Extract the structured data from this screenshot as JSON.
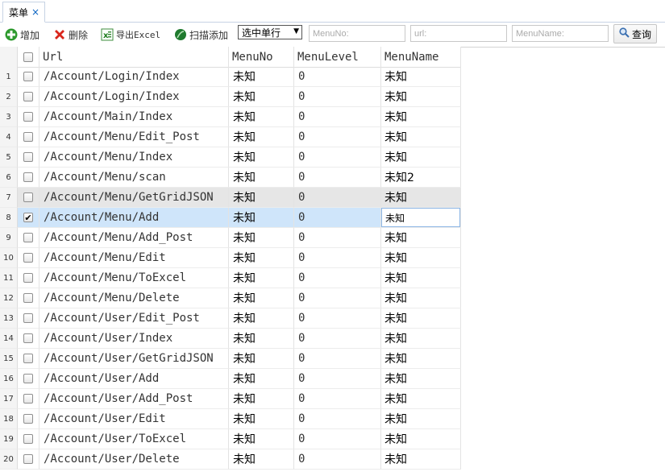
{
  "tab": {
    "label": "菜单",
    "close": "×"
  },
  "toolbar": {
    "add": "增加",
    "delete": "删除",
    "export": "导出Excel",
    "scan": "扫描添加",
    "select_mode": "选中单行",
    "menuno_placeholder": "MenuNo:",
    "url_placeholder": "url:",
    "menuname_placeholder": "MenuName:",
    "query": "查询"
  },
  "icons": {
    "add": "plus-icon",
    "delete": "red-x-icon",
    "export": "excel-icon",
    "scan": "scan-icon",
    "query": "magnifier-icon"
  },
  "colors": {
    "selected_row": "#cfe5fa",
    "hover_row": "#e6e6e6",
    "tab_close": "#0a63c2"
  },
  "grid": {
    "headers": {
      "url": "Url",
      "menuno": "MenuNo",
      "menulevel": "MenuLevel",
      "menuname": "MenuName"
    },
    "selected_row": 8,
    "hover_row": 7,
    "rows": [
      {
        "num": "1",
        "url": "/Account/Login/Index",
        "menuno": "未知",
        "level": "0",
        "name": "未知"
      },
      {
        "num": "2",
        "url": "/Account/Login/Index",
        "menuno": "未知",
        "level": "0",
        "name": "未知"
      },
      {
        "num": "3",
        "url": "/Account/Main/Index",
        "menuno": "未知",
        "level": "0",
        "name": "未知"
      },
      {
        "num": "4",
        "url": "/Account/Menu/Edit_Post",
        "menuno": "未知",
        "level": "0",
        "name": "未知"
      },
      {
        "num": "5",
        "url": "/Account/Menu/Index",
        "menuno": "未知",
        "level": "0",
        "name": "未知"
      },
      {
        "num": "6",
        "url": "/Account/Menu/scan",
        "menuno": "未知",
        "level": "0",
        "name": "未知2"
      },
      {
        "num": "7",
        "url": "/Account/Menu/GetGridJSON",
        "menuno": "未知",
        "level": "0",
        "name": "未知"
      },
      {
        "num": "8",
        "url": "/Account/Menu/Add",
        "menuno": "未知",
        "level": "0",
        "name": "未知"
      },
      {
        "num": "9",
        "url": "/Account/Menu/Add_Post",
        "menuno": "未知",
        "level": "0",
        "name": "未知"
      },
      {
        "num": "10",
        "url": "/Account/Menu/Edit",
        "menuno": "未知",
        "level": "0",
        "name": "未知"
      },
      {
        "num": "11",
        "url": "/Account/Menu/ToExcel",
        "menuno": "未知",
        "level": "0",
        "name": "未知"
      },
      {
        "num": "12",
        "url": "/Account/Menu/Delete",
        "menuno": "未知",
        "level": "0",
        "name": "未知"
      },
      {
        "num": "13",
        "url": "/Account/User/Edit_Post",
        "menuno": "未知",
        "level": "0",
        "name": "未知"
      },
      {
        "num": "14",
        "url": "/Account/User/Index",
        "menuno": "未知",
        "level": "0",
        "name": "未知"
      },
      {
        "num": "15",
        "url": "/Account/User/GetGridJSON",
        "menuno": "未知",
        "level": "0",
        "name": "未知"
      },
      {
        "num": "16",
        "url": "/Account/User/Add",
        "menuno": "未知",
        "level": "0",
        "name": "未知"
      },
      {
        "num": "17",
        "url": "/Account/User/Add_Post",
        "menuno": "未知",
        "level": "0",
        "name": "未知"
      },
      {
        "num": "18",
        "url": "/Account/User/Edit",
        "menuno": "未知",
        "level": "0",
        "name": "未知"
      },
      {
        "num": "19",
        "url": "/Account/User/ToExcel",
        "menuno": "未知",
        "level": "0",
        "name": "未知"
      },
      {
        "num": "20",
        "url": "/Account/User/Delete",
        "menuno": "未知",
        "level": "0",
        "name": "未知"
      }
    ]
  }
}
